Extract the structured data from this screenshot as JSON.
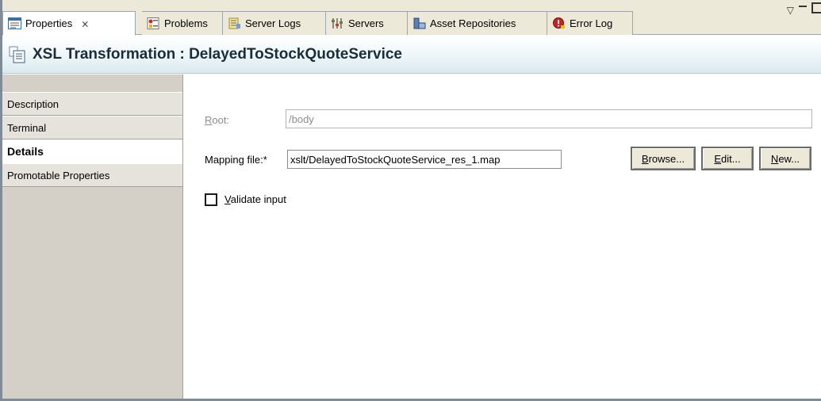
{
  "tabs": [
    {
      "label": "Properties",
      "icon": "properties-icon",
      "active": true
    },
    {
      "label": "Problems",
      "icon": "problems-icon"
    },
    {
      "label": "Server Logs",
      "icon": "server-logs-icon"
    },
    {
      "label": "Servers",
      "icon": "servers-icon"
    },
    {
      "label": "Asset Repositories",
      "icon": "asset-repositories-icon"
    },
    {
      "label": "Error Log",
      "icon": "error-log-icon"
    }
  ],
  "tab_close_glyph": "⨯",
  "header": {
    "title": "XSL Transformation : DelayedToStockQuoteService",
    "icon": "xsl-document-icon"
  },
  "sidebar": {
    "items": [
      {
        "label": "Description"
      },
      {
        "label": "Terminal"
      },
      {
        "label": "Details",
        "active": true
      },
      {
        "label": "Promotable Properties"
      }
    ]
  },
  "form": {
    "root_label_first": "R",
    "root_label_rest": "oot:",
    "root_value": "/body",
    "mapping_label": "Mapping file:*",
    "mapping_value": "xslt/DelayedToStockQuoteService_res_1.map",
    "browse_label_first": "B",
    "browse_label_rest": "rowse...",
    "edit_label_first": "E",
    "edit_label_rest": "dit...",
    "new_label_first": "N",
    "new_label_rest": "ew...",
    "validate_first": "V",
    "validate_rest": "alidate input",
    "validate_checked": false
  },
  "colors": {
    "header_title": "#1a2d3a",
    "sidebar_bg": "#d4d0c8",
    "tabbar_bg": "#ece9d8"
  }
}
